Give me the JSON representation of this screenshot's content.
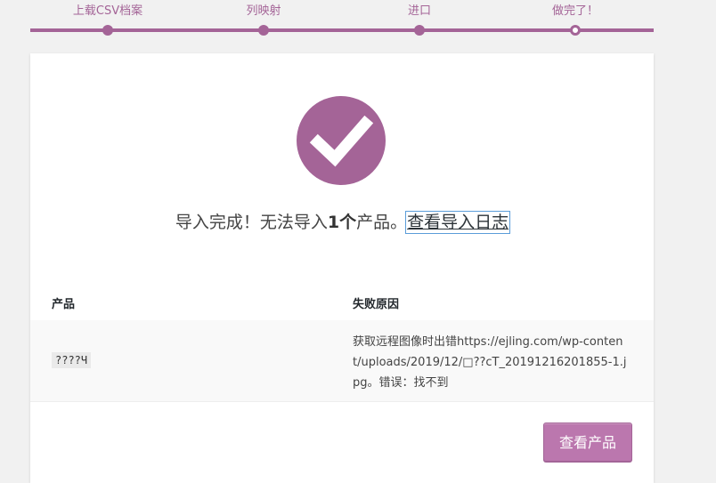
{
  "steps": [
    {
      "label": "上载CSV档案",
      "state": "done"
    },
    {
      "label": "列映射",
      "state": "done"
    },
    {
      "label": "进口",
      "state": "done"
    },
    {
      "label": "做完了！",
      "state": "current"
    }
  ],
  "colors": {
    "accent": "#a46497",
    "button": "#bb77ae"
  },
  "done": {
    "icon": "checkmark-icon",
    "msg_prefix": "导入完成！无法导入",
    "count": "1个",
    "msg_suffix": "产品。",
    "log_link": "查看导入日志"
  },
  "table": {
    "col_product": "产品",
    "col_reason": "失败原因",
    "rows": [
      {
        "product": "????Ч",
        "reason": "获取远程图像时出错https://ejling.com/wp-content/uploads/2019/12/□??cT_20191216201855-1.jpg。错误：找不到"
      }
    ]
  },
  "button": {
    "view_products": "查看产品"
  }
}
